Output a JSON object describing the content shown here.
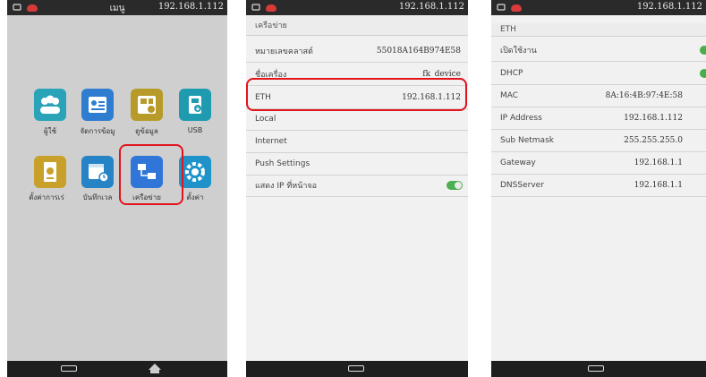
{
  "screen1": {
    "title": "เมนู",
    "ip": "192.168.1.112",
    "apps": [
      {
        "label": "ผู้ใช้",
        "color": "#2aa3b8",
        "icon": "users-icon"
      },
      {
        "label": "จัดการข้อมู",
        "color": "#2e7dd1",
        "icon": "id-card-icon"
      },
      {
        "label": "ดูข้อมูล",
        "color": "#b89a2a",
        "icon": "data-view-icon"
      },
      {
        "label": "USB",
        "color": "#1f9bb0",
        "icon": "usb-icon"
      },
      {
        "label": "ตั้งค่าการเร่",
        "color": "#c9a12a",
        "icon": "door-settings-icon"
      },
      {
        "label": "บันทึกเวล",
        "color": "#2683c6",
        "icon": "calendar-clock-icon"
      },
      {
        "label": "เครือข่าย",
        "color": "#2f76d8",
        "icon": "network-icon"
      },
      {
        "label": "ตั้งค่า",
        "color": "#1f93c9",
        "icon": "gear-icon"
      }
    ]
  },
  "screen2": {
    "ip": "192.168.1.112",
    "header": "เครือข่าย",
    "rows": [
      {
        "label": "หมายเลขคลาสต์",
        "value": "55018A164B974E58"
      },
      {
        "label": "ชื่อเครื่อง",
        "value": "fk_device"
      },
      {
        "label": "ETH",
        "value": "192.168.1.112"
      },
      {
        "label": "Local",
        "value": ""
      },
      {
        "label": "Internet",
        "value": ""
      },
      {
        "label": "Push Settings",
        "value": ""
      },
      {
        "label": "แสดง IP ที่หน้าจอ",
        "value": ""
      }
    ]
  },
  "screen3": {
    "ip": "192.168.1.112",
    "header": "ETH",
    "rows": [
      {
        "label": "เปิดใช้งาน",
        "value": ""
      },
      {
        "label": "DHCP",
        "value": ""
      },
      {
        "label": "MAC",
        "value": "8A:16:4B:97:4E:58"
      },
      {
        "label": "IP Address",
        "value": "192.168.1.112"
      },
      {
        "label": "Sub Netmask",
        "value": "255.255.255.0"
      },
      {
        "label": "Gateway",
        "value": "192.168.1.1"
      },
      {
        "label": "DNSServer",
        "value": "192.168.1.1"
      }
    ]
  },
  "colors": {
    "highlight": "#e3131b",
    "toggle_on": "#4caf50",
    "status_bar": "#2a2a2a"
  }
}
